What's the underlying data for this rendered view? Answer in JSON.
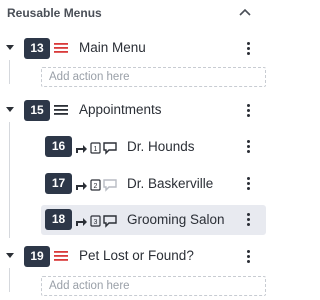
{
  "panel": {
    "title": "Reusable Menus"
  },
  "menus": [
    {
      "number": "13",
      "label": "Main Menu",
      "icon_color": "#d93a3a",
      "add_action_placeholder": "Add action here"
    },
    {
      "number": "15",
      "label": "Appointments",
      "icon_color": "#2b2f36",
      "children": [
        {
          "number": "16",
          "label": "Dr. Hounds",
          "step": "1",
          "chat_active": true
        },
        {
          "number": "17",
          "label": "Dr. Baskerville",
          "step": "2",
          "chat_active": false
        },
        {
          "number": "18",
          "label": "Grooming Salon",
          "step": "3",
          "chat_active": true,
          "selected": true
        }
      ]
    },
    {
      "number": "19",
      "label": "Pet Lost or Found?",
      "icon_color": "#d93a3a",
      "add_action_placeholder": "Add action here"
    }
  ]
}
